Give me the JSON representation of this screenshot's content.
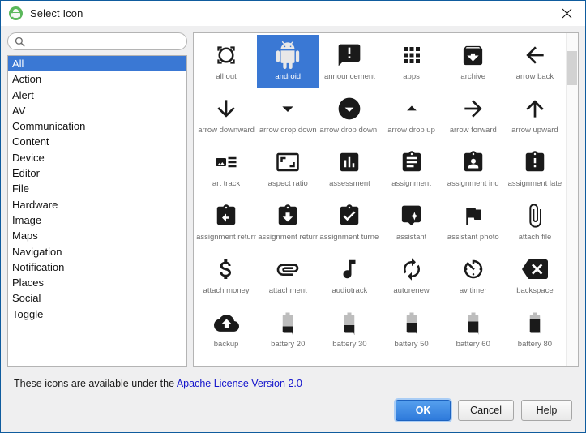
{
  "window": {
    "title": "Select Icon",
    "app_icon": "android-green-icon",
    "close_label": "✕"
  },
  "search": {
    "value": "",
    "placeholder": "",
    "icon": "search-icon"
  },
  "categories": {
    "selected": "All",
    "items": [
      "All",
      "Action",
      "Alert",
      "AV",
      "Communication",
      "Content",
      "Device",
      "Editor",
      "File",
      "Hardware",
      "Image",
      "Maps",
      "Navigation",
      "Notification",
      "Places",
      "Social",
      "Toggle"
    ]
  },
  "icon_grid": {
    "selected": "android",
    "columns": 6,
    "items": [
      {
        "label": "all out",
        "icon": "all-out-icon"
      },
      {
        "label": "android",
        "icon": "android-icon"
      },
      {
        "label": "announcement",
        "icon": "announcement-icon"
      },
      {
        "label": "apps",
        "icon": "apps-icon"
      },
      {
        "label": "archive",
        "icon": "archive-icon"
      },
      {
        "label": "arrow back",
        "icon": "arrow-back-icon"
      },
      {
        "label": "arrow downward",
        "icon": "arrow-downward-icon"
      },
      {
        "label": "arrow drop down",
        "icon": "arrow-drop-down-icon"
      },
      {
        "label": "arrow drop down c",
        "icon": "arrow-drop-down-circle-icon"
      },
      {
        "label": "arrow drop up",
        "icon": "arrow-drop-up-icon"
      },
      {
        "label": "arrow forward",
        "icon": "arrow-forward-icon"
      },
      {
        "label": "arrow upward",
        "icon": "arrow-upward-icon"
      },
      {
        "label": "art track",
        "icon": "art-track-icon"
      },
      {
        "label": "aspect ratio",
        "icon": "aspect-ratio-icon"
      },
      {
        "label": "assessment",
        "icon": "assessment-icon"
      },
      {
        "label": "assignment",
        "icon": "assignment-icon"
      },
      {
        "label": "assignment ind",
        "icon": "assignment-ind-icon"
      },
      {
        "label": "assignment late",
        "icon": "assignment-late-icon"
      },
      {
        "label": "assignment return",
        "icon": "assignment-return-icon"
      },
      {
        "label": "assignment return",
        "icon": "assignment-returned-icon"
      },
      {
        "label": "assignment turned",
        "icon": "assignment-turned-in-icon"
      },
      {
        "label": "assistant",
        "icon": "assistant-icon"
      },
      {
        "label": "assistant photo",
        "icon": "assistant-photo-icon"
      },
      {
        "label": "attach file",
        "icon": "attach-file-icon"
      },
      {
        "label": "attach money",
        "icon": "attach-money-icon"
      },
      {
        "label": "attachment",
        "icon": "attachment-icon"
      },
      {
        "label": "audiotrack",
        "icon": "audiotrack-icon"
      },
      {
        "label": "autorenew",
        "icon": "autorenew-icon"
      },
      {
        "label": "av timer",
        "icon": "av-timer-icon"
      },
      {
        "label": "backspace",
        "icon": "backspace-icon"
      },
      {
        "label": "backup",
        "icon": "backup-icon"
      },
      {
        "label": "battery 20",
        "icon": "battery-20-icon"
      },
      {
        "label": "battery 30",
        "icon": "battery-30-icon"
      },
      {
        "label": "battery 50",
        "icon": "battery-50-icon"
      },
      {
        "label": "battery 60",
        "icon": "battery-60-icon"
      },
      {
        "label": "battery 80",
        "icon": "battery-80-icon"
      },
      {
        "label": "",
        "icon": "battery-90-icon"
      },
      {
        "label": "",
        "icon": "battery-full-icon"
      },
      {
        "label": "",
        "icon": "battery-charging-20-icon"
      },
      {
        "label": "",
        "icon": "battery-charging-30-icon"
      },
      {
        "label": "",
        "icon": "battery-charging-50-icon"
      },
      {
        "label": "",
        "icon": "battery-charging-60-icon"
      }
    ]
  },
  "footer": {
    "license_prefix": "These icons are available under the ",
    "license_link": "Apache License Version 2.0",
    "buttons": {
      "ok": "OK",
      "cancel": "Cancel",
      "help": "Help"
    }
  },
  "colors": {
    "selection_blue": "#3a78d4",
    "link_blue": "#1414cc",
    "primary_button": "#2e7adb"
  }
}
